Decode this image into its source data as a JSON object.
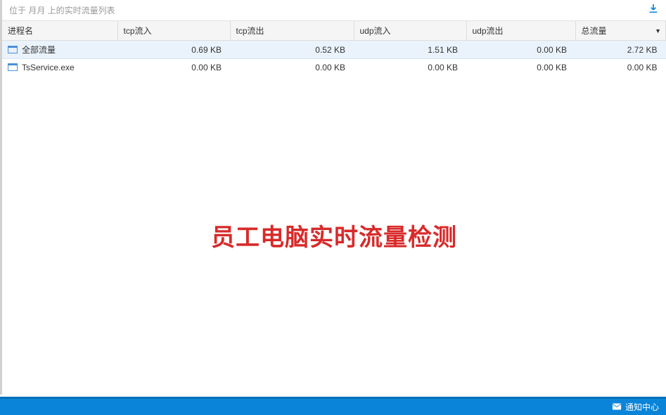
{
  "header": {
    "title": "位于 月月 上的实时流量列表"
  },
  "table": {
    "columns": {
      "process": "进程名",
      "tcpin": "tcp流入",
      "tcpout": "tcp流出",
      "udpin": "udp流入",
      "udpout": "udp流出",
      "total": "总流量"
    },
    "rows": [
      {
        "process": "全部流量",
        "tcpin": "0.69 KB",
        "tcpout": "0.52 KB",
        "udpin": "1.51 KB",
        "udpout": "0.00 KB",
        "total": "2.72 KB"
      },
      {
        "process": "TsService.exe",
        "tcpin": "0.00 KB",
        "tcpout": "0.00 KB",
        "udpin": "0.00 KB",
        "udpout": "0.00 KB",
        "total": "0.00 KB"
      }
    ]
  },
  "overlay": {
    "text": "员工电脑实时流量检测"
  },
  "statusbar": {
    "notification": "通知中心"
  }
}
